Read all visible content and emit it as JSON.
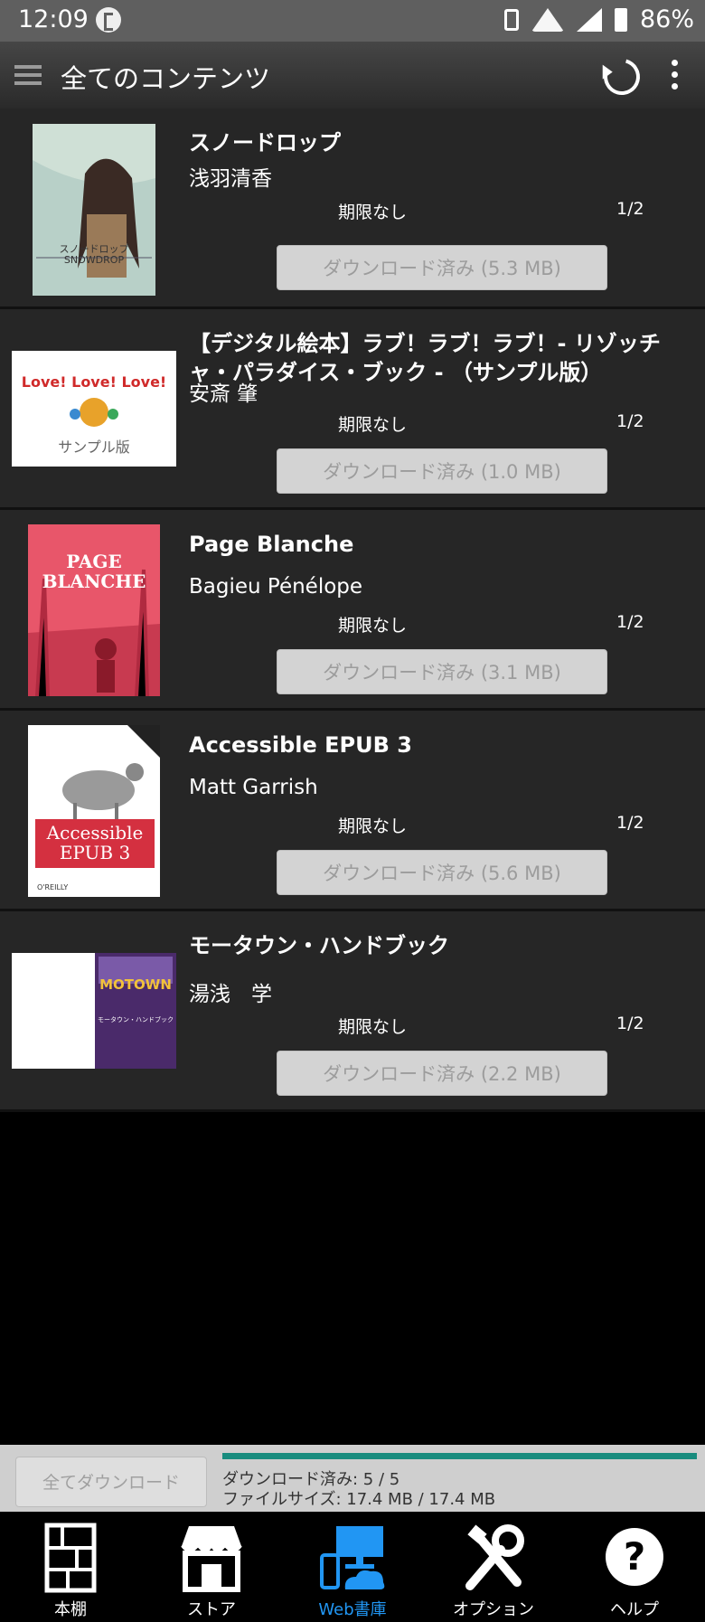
{
  "status": {
    "time": "12:09",
    "battery": "86%"
  },
  "app_bar": {
    "title": "全てのコンテンツ"
  },
  "books": [
    {
      "title": "スノードロップ",
      "author": "浅羽清香",
      "limit": "期限なし",
      "pages": "1/2",
      "download": "ダウンロード済み (5.3 MB)"
    },
    {
      "title": "【デジタル絵本】ラブ！ラブ！ラブ！- リゾッチャ・パラダイス・ブック - （サンプル版）",
      "author": "安斎 肇",
      "limit": "期限なし",
      "pages": "1/2",
      "download": "ダウンロード済み (1.0 MB)"
    },
    {
      "title": "Page Blanche",
      "author": "Bagieu Pénélope",
      "limit": "期限なし",
      "pages": "1/2",
      "download": "ダウンロード済み (3.1 MB)"
    },
    {
      "title": "Accessible EPUB 3",
      "author": "Matt Garrish",
      "limit": "期限なし",
      "pages": "1/2",
      "download": "ダウンロード済み (5.6 MB)"
    },
    {
      "title": "モータウン・ハンドブック",
      "author": "湯浅　学",
      "limit": "期限なし",
      "pages": "1/2",
      "download": "ダウンロード済み (2.2 MB)"
    }
  ],
  "covers": {
    "snowdrop": "スノードロップ\nSNOWDROP",
    "love": "Love! Love! Love!",
    "love_sample": "サンプル版",
    "page_blanche": "PAGE\nBLANCHE",
    "epub_title": "Accessible\nEPUB 3",
    "epub_pub": "O'REILLY",
    "motown": "MOTOWN",
    "motown_sub": "モータウン・ハンドブック"
  },
  "bottom": {
    "download_all": "全てダウンロード",
    "progress": 1.0,
    "downloaded": "ダウンロード済み: 5 / 5",
    "filesize": "ファイルサイズ: 17.4 MB / 17.4 MB"
  },
  "tabs": [
    {
      "label": "本棚",
      "icon": "bookshelf-icon"
    },
    {
      "label": "ストア",
      "icon": "store-icon"
    },
    {
      "label": "Web書庫",
      "icon": "web-library-icon",
      "active": true
    },
    {
      "label": "オプション",
      "icon": "tools-icon"
    },
    {
      "label": "ヘルプ",
      "icon": "help-icon"
    }
  ],
  "colors": {
    "accent": "#2196f3",
    "progress": "#188c7e"
  }
}
